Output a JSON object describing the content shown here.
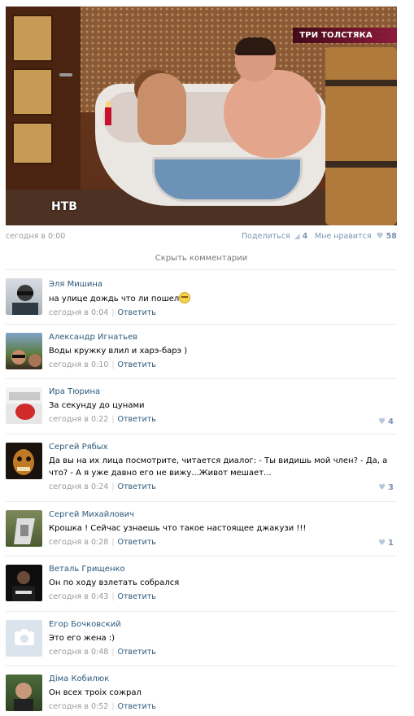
{
  "post": {
    "channel_badge": "ТРИ ТОЛСТЯКА",
    "channel_logo": "НТВ",
    "date": "сегодня в 0:00",
    "share_label": "Поделиться",
    "share_count": "4",
    "like_label": "Мне нравится",
    "like_count": "58"
  },
  "hide_comments_label": "Скрыть комментарии",
  "comments": [
    {
      "author": "Эля Мишина",
      "text": "на улице дождь что ли пошел",
      "date": "сегодня в 0:04",
      "reply": "Ответить",
      "likes": "",
      "emoji": "smiley-icon"
    },
    {
      "author": "Александр Игнатьев",
      "text": "Воды кружку влил и харэ-барэ )",
      "date": "сегодня в 0:10",
      "reply": "Ответить",
      "likes": ""
    },
    {
      "author": "Ира Тюрина",
      "text": "За секунду до цунами",
      "date": "сегодня в 0:22",
      "reply": "Ответить",
      "likes": "4"
    },
    {
      "author": "Сергей Рябых",
      "text": "Да вы на их лица посмотрите, читается диалог: - Ты видишь мой член? - Да, а что? - А я уже давно его не вижу...Живот мешает...",
      "date": "сегодня в 0:24",
      "reply": "Ответить",
      "likes": "3"
    },
    {
      "author": "Сергей Михайлович",
      "text": "Крошка ! Сейчас узнаешь что такое настоящее джакузи !!!",
      "date": "сегодня в 0:28",
      "reply": "Ответить",
      "likes": "1"
    },
    {
      "author": "Веталь Грищенко",
      "text": "Он по ходу взлетать собрался",
      "date": "сегодня в 0:43",
      "reply": "Ответить",
      "likes": ""
    },
    {
      "author": "Егор Бочковский",
      "text": "Это его жена :)",
      "date": "сегодня в 0:48",
      "reply": "Ответить",
      "likes": ""
    },
    {
      "author": "Діма Кобилюк",
      "text": "Он всех троіх сожрал",
      "date": "сегодня в 0:52",
      "reply": "Ответить",
      "likes": ""
    }
  ],
  "colors": {
    "link": "#2b587a",
    "meta": "#999999",
    "like_accent": "#7b95b3",
    "divider": "#e7ebef"
  }
}
